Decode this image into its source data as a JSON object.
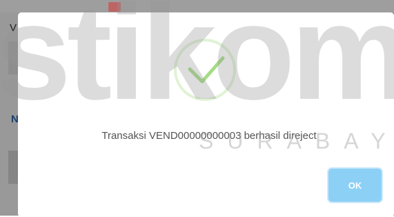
{
  "background": {
    "partial_title": "V",
    "partial_link": "N"
  },
  "dialog": {
    "icon": "success-check-icon",
    "message": "Transaksi VEND00000000003 berhasil direject",
    "ok_label": "OK"
  },
  "watermark": {
    "main": "stikom",
    "sub": "SURABAYA"
  },
  "colors": {
    "success": "#a5dc86",
    "ok_button": "#8dd0f5",
    "message_text": "#545454"
  }
}
